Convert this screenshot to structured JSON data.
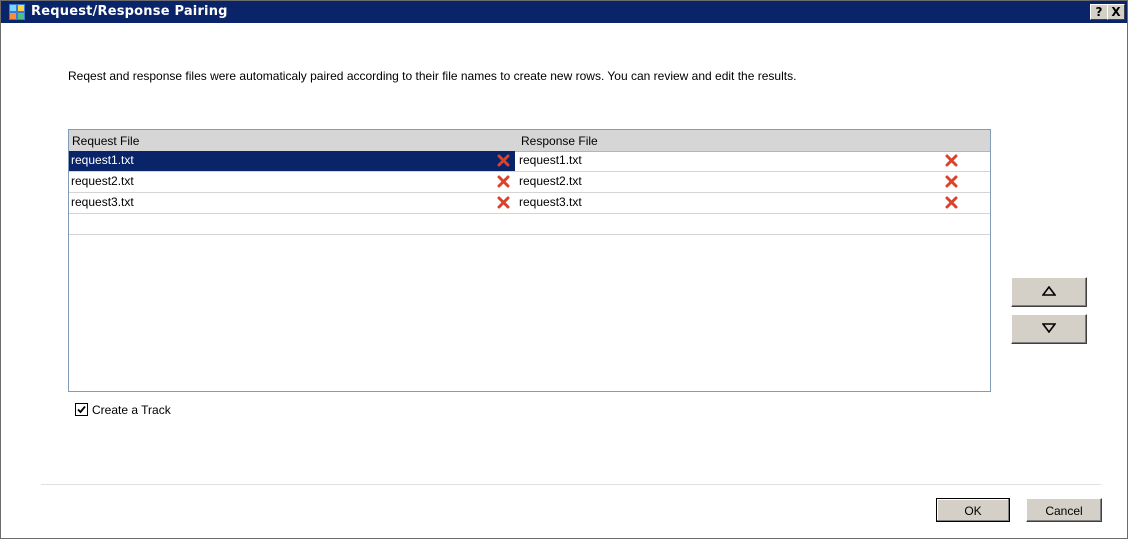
{
  "window": {
    "title": "Request/Response Pairing",
    "help_label": "?",
    "close_label": "X"
  },
  "description": "Reqest and response files were automaticaly paired according to their file names to create new rows. You can review and edit the results.",
  "grid": {
    "columns": [
      "Request File",
      "Response File"
    ],
    "rows": [
      {
        "request": "request1.txt",
        "response": "request1.txt",
        "selected": true
      },
      {
        "request": "request2.txt",
        "response": "request2.txt",
        "selected": false
      },
      {
        "request": "request3.txt",
        "response": "request3.txt",
        "selected": false
      }
    ]
  },
  "side_buttons": {
    "up": "move-up-icon",
    "down": "move-down-icon"
  },
  "create_track": {
    "label": "Create a Track",
    "checked": true
  },
  "footer": {
    "ok_label": "OK",
    "cancel_label": "Cancel"
  },
  "colors": {
    "titlebar": "#0a246a",
    "selection": "#0a246a",
    "remove_icon": "#d9432b"
  }
}
